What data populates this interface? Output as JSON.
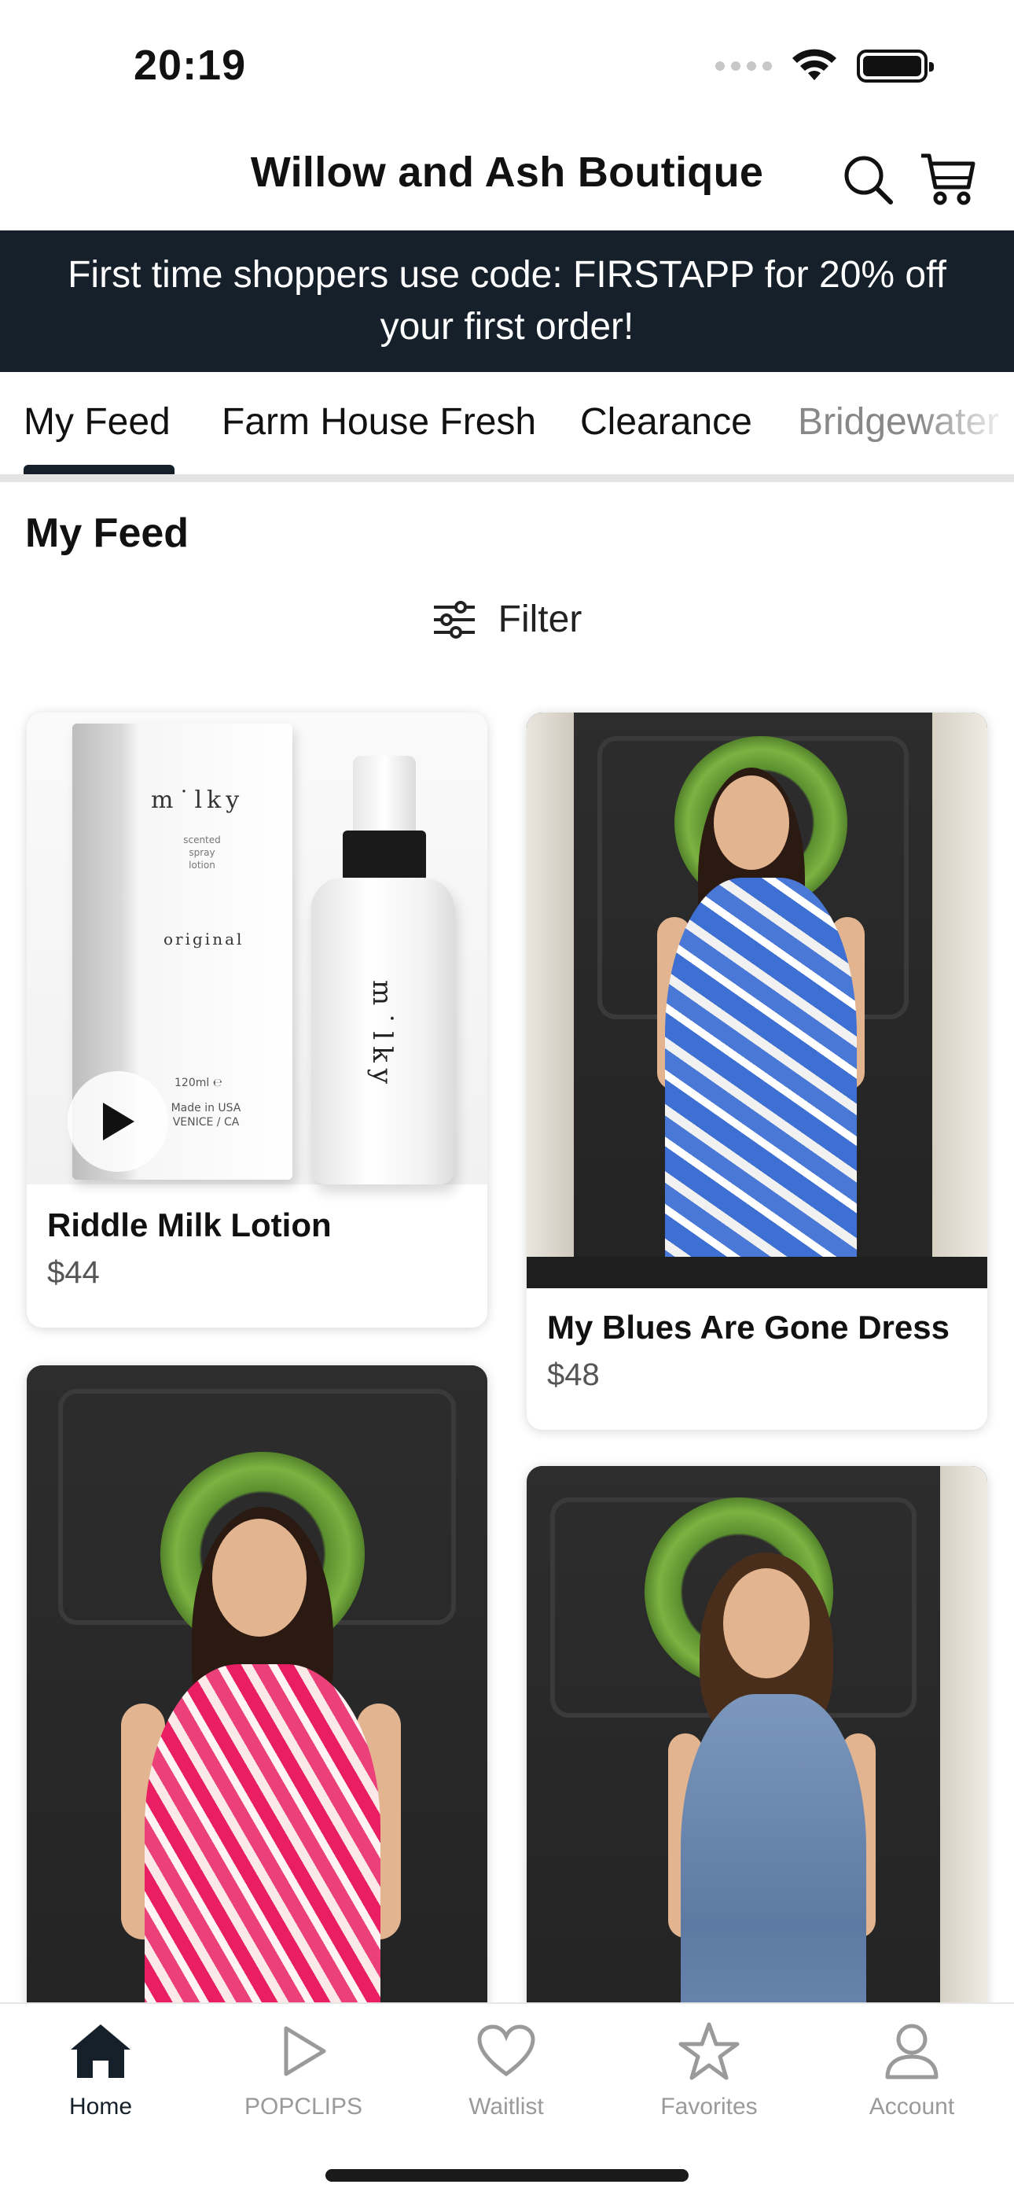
{
  "status_bar": {
    "time": "20:19"
  },
  "header": {
    "title": "Willow and Ash Boutique",
    "search_icon": "search-icon",
    "cart_icon": "cart-icon"
  },
  "promo": {
    "text": "First time shoppers use code: FIRSTAPP for 20% off your first order!"
  },
  "tabs": [
    {
      "label": "My Feed",
      "active": true
    },
    {
      "label": "Farm House Fresh",
      "active": false
    },
    {
      "label": "Clearance",
      "active": false
    },
    {
      "label": "Bridgewater",
      "active": false
    }
  ],
  "section": {
    "title": "My Feed",
    "filter_label": "Filter",
    "filter_icon": "sliders-icon"
  },
  "products": [
    {
      "name": "Riddle Milk Lotion",
      "price": "$44",
      "has_video": true
    },
    {
      "name": "My Blues Are Gone Dress",
      "price": "$48",
      "has_video": false
    },
    {
      "name": "",
      "price": "",
      "has_video": false
    },
    {
      "name": "",
      "price": "",
      "has_video": false
    }
  ],
  "lotion_packaging": {
    "brand": "m˙lky",
    "subtitle": "scented spray lotion",
    "variant": "original",
    "volume": "120ml ℮",
    "origin": "Made in USA VENICE / CA"
  },
  "bottom_nav": [
    {
      "label": "Home",
      "icon": "home-icon",
      "active": true
    },
    {
      "label": "POPCLIPS",
      "icon": "play-icon",
      "active": false
    },
    {
      "label": "Waitlist",
      "icon": "heart-icon",
      "active": false
    },
    {
      "label": "Favorites",
      "icon": "star-icon",
      "active": false
    },
    {
      "label": "Account",
      "icon": "person-icon",
      "active": false
    }
  ],
  "colors": {
    "navy": "#15202b",
    "inactive": "#9a9a9a"
  }
}
